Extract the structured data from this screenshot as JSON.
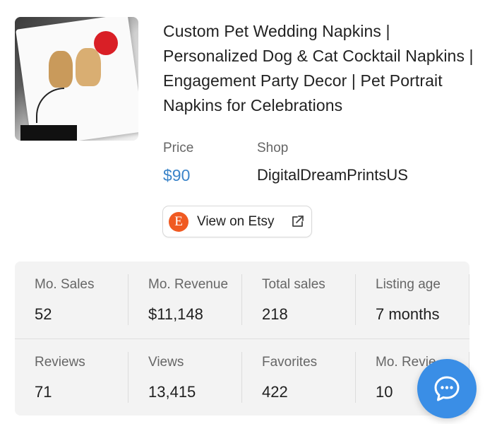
{
  "product": {
    "title": "Custom Pet Wedding Napkins | Personalized Dog & Cat Cocktail Napkins | Engagement Party Decor | Pet Portrait Napkins for Celebrations",
    "image_icon": "product-photo"
  },
  "meta": {
    "price_label": "Price",
    "price_value": "$90",
    "shop_label": "Shop",
    "shop_value": "DigitalDreamPrintsUS",
    "price_color": "#3b84c9"
  },
  "etsy_button": {
    "logo_letter": "E",
    "label": "View on Etsy",
    "icon": "external-link-icon",
    "brand_color": "#f05a22"
  },
  "stats": {
    "row1": [
      {
        "label": "Mo. Sales",
        "value": "52"
      },
      {
        "label": "Mo. Revenue",
        "value": "$11,148"
      },
      {
        "label": "Total sales",
        "value": "218"
      },
      {
        "label": "Listing age",
        "value": "7 months"
      }
    ],
    "row2": [
      {
        "label": "Reviews",
        "value": "71"
      },
      {
        "label": "Views",
        "value": "13,415"
      },
      {
        "label": "Favorites",
        "value": "422"
      },
      {
        "label": "Mo. Revie",
        "value": "10"
      }
    ]
  },
  "chat": {
    "icon": "chat-bubble-icon",
    "color": "#3a8ee6"
  }
}
